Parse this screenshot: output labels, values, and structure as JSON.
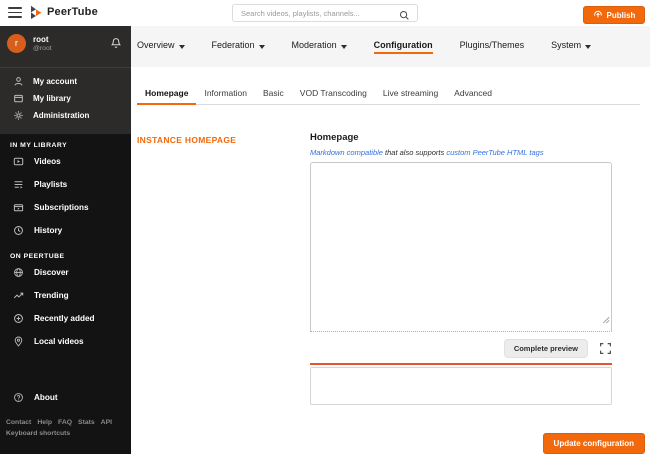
{
  "colors": {
    "accent": "#f2690d",
    "error_line": "#e5552f",
    "link": "#3470db",
    "sidebar_bg": "#141313",
    "sidebar_top_bg": "#2c2b29",
    "nav_strip_bg": "#f5f5f5"
  },
  "topbar": {
    "brand": "PeerTube",
    "search_placeholder": "Search videos, playlists, channels...",
    "publish_label": "Publish"
  },
  "sidebar": {
    "user": {
      "initial": "r",
      "name": "root",
      "handle": "@root"
    },
    "account_links": [
      {
        "label": "My account"
      },
      {
        "label": "My library"
      },
      {
        "label": "Administration"
      }
    ],
    "sections": [
      {
        "title": "IN MY LIBRARY",
        "items": [
          {
            "label": "Videos"
          },
          {
            "label": "Playlists"
          },
          {
            "label": "Subscriptions"
          },
          {
            "label": "History"
          }
        ]
      },
      {
        "title": "ON PEERTUBE",
        "items": [
          {
            "label": "Discover"
          },
          {
            "label": "Trending"
          },
          {
            "label": "Recently added"
          },
          {
            "label": "Local videos"
          }
        ]
      }
    ],
    "about_label": "About",
    "footer_links": [
      {
        "label": "Contact"
      },
      {
        "label": "Help"
      },
      {
        "label": "FAQ"
      },
      {
        "label": "Stats"
      },
      {
        "label": "API"
      }
    ],
    "footer_links_secondary": [
      {
        "label": "Keyboard shortcuts"
      }
    ]
  },
  "nav": {
    "items": [
      {
        "label": "Overview"
      },
      {
        "label": "Federation"
      },
      {
        "label": "Moderation"
      },
      {
        "label": "Configuration"
      },
      {
        "label": "Plugins/Themes"
      },
      {
        "label": "System"
      }
    ]
  },
  "subtabs": {
    "items": [
      {
        "label": "Homepage"
      },
      {
        "label": "Information"
      },
      {
        "label": "Basic"
      },
      {
        "label": "VOD Transcoding"
      },
      {
        "label": "Live streaming"
      },
      {
        "label": "Advanced"
      }
    ]
  },
  "form": {
    "section_label": "INSTANCE HOMEPAGE",
    "field_label": "Homepage",
    "hint_link_1": "Markdown compatible",
    "hint_middle": " that also supports ",
    "hint_link_2": "custom PeerTube HTML tags",
    "textarea_value": "",
    "preview_button_label": "Complete preview",
    "submit_label": "Update configuration"
  }
}
